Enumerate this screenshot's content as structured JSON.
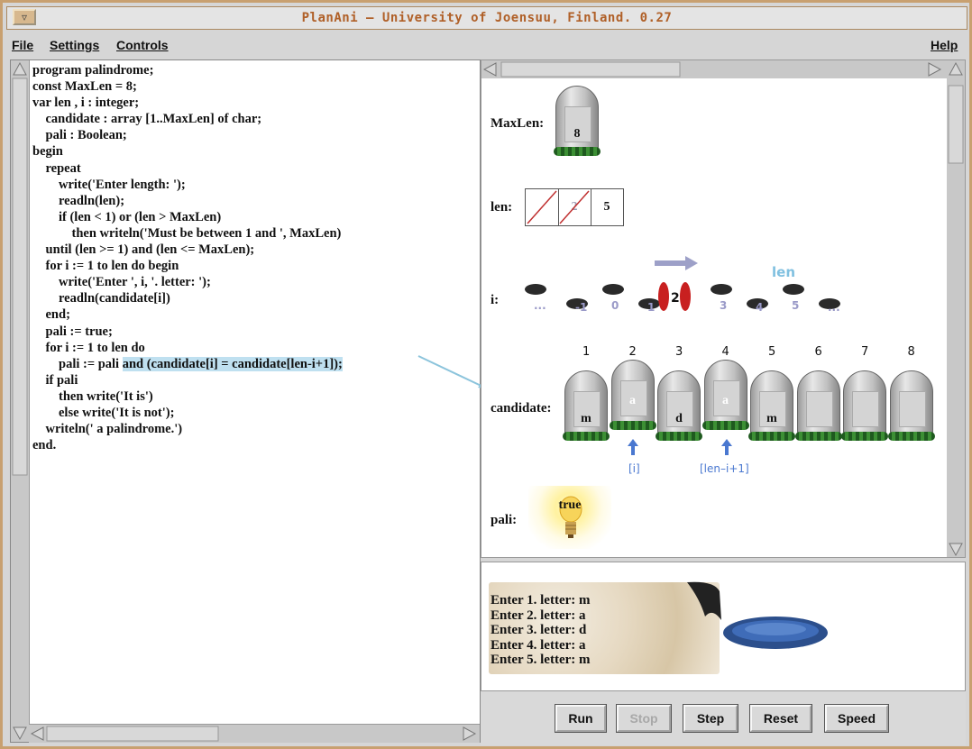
{
  "window": {
    "title": "PlanAni  – University of Joensuu, Finland. 0.27"
  },
  "menubar": {
    "file": "File",
    "settings": "Settings",
    "controls": "Controls",
    "help": "Help"
  },
  "code": {
    "lines": [
      "program palindrome;",
      "const MaxLen = 8;",
      "var len , i : integer;",
      "    candidate : array [1..MaxLen] of char;",
      "    pali : Boolean;",
      "begin",
      "    repeat",
      "        write('Enter length: ');",
      "        readln(len);",
      "        if (len < 1) or (len > MaxLen)",
      "            then writeln('Must be between 1 and ', MaxLen)",
      "    until (len >= 1) and (len <= MaxLen);",
      "    for i := 1 to len do begin",
      "        write('Enter ', i, '. letter: ');",
      "        readln(candidate[i])",
      "    end;",
      "    pali := true;",
      "    for i := 1 to len do",
      "        pali := pali ",
      "    if pali",
      "        then write('It is')",
      "        else write('It is not');",
      "    writeln(' a palindrome.')",
      "end."
    ],
    "highlight": "and (candidate[i] = candidate[len-i+1]);"
  },
  "vars": {
    "maxlen": {
      "label": "MaxLen:",
      "value": "8"
    },
    "len": {
      "label": "len:",
      "history": [
        "",
        "2",
        "5"
      ]
    },
    "i": {
      "label": "i:",
      "limit_label": "len",
      "current": "2",
      "steps": [
        "...",
        "-1",
        "0",
        "1",
        "3",
        "4",
        "5",
        "..."
      ]
    },
    "candidate": {
      "label": "candidate:",
      "indices": [
        "1",
        "2",
        "3",
        "4",
        "5",
        "6",
        "7",
        "8"
      ],
      "values": [
        "m",
        "a",
        "d",
        "a",
        "m",
        "",
        "",
        ""
      ],
      "pointer_i": "[i]",
      "pointer_rev": "[len–i+1]"
    },
    "pali": {
      "label": "pali:",
      "value": "true"
    }
  },
  "console": {
    "lines": [
      "Enter 1. letter: m",
      "Enter 2. letter: a",
      "Enter 3. letter: d",
      "Enter 4. letter: a",
      "Enter 5. letter: m"
    ]
  },
  "buttons": {
    "run": "Run",
    "stop": "Stop",
    "step": "Step",
    "reset": "Reset",
    "speed": "Speed"
  },
  "colors": {
    "title": "#b06028",
    "highlight": "#bfe0f0",
    "pointer": "#4a78d0",
    "lenLabel": "#80c0e0"
  }
}
